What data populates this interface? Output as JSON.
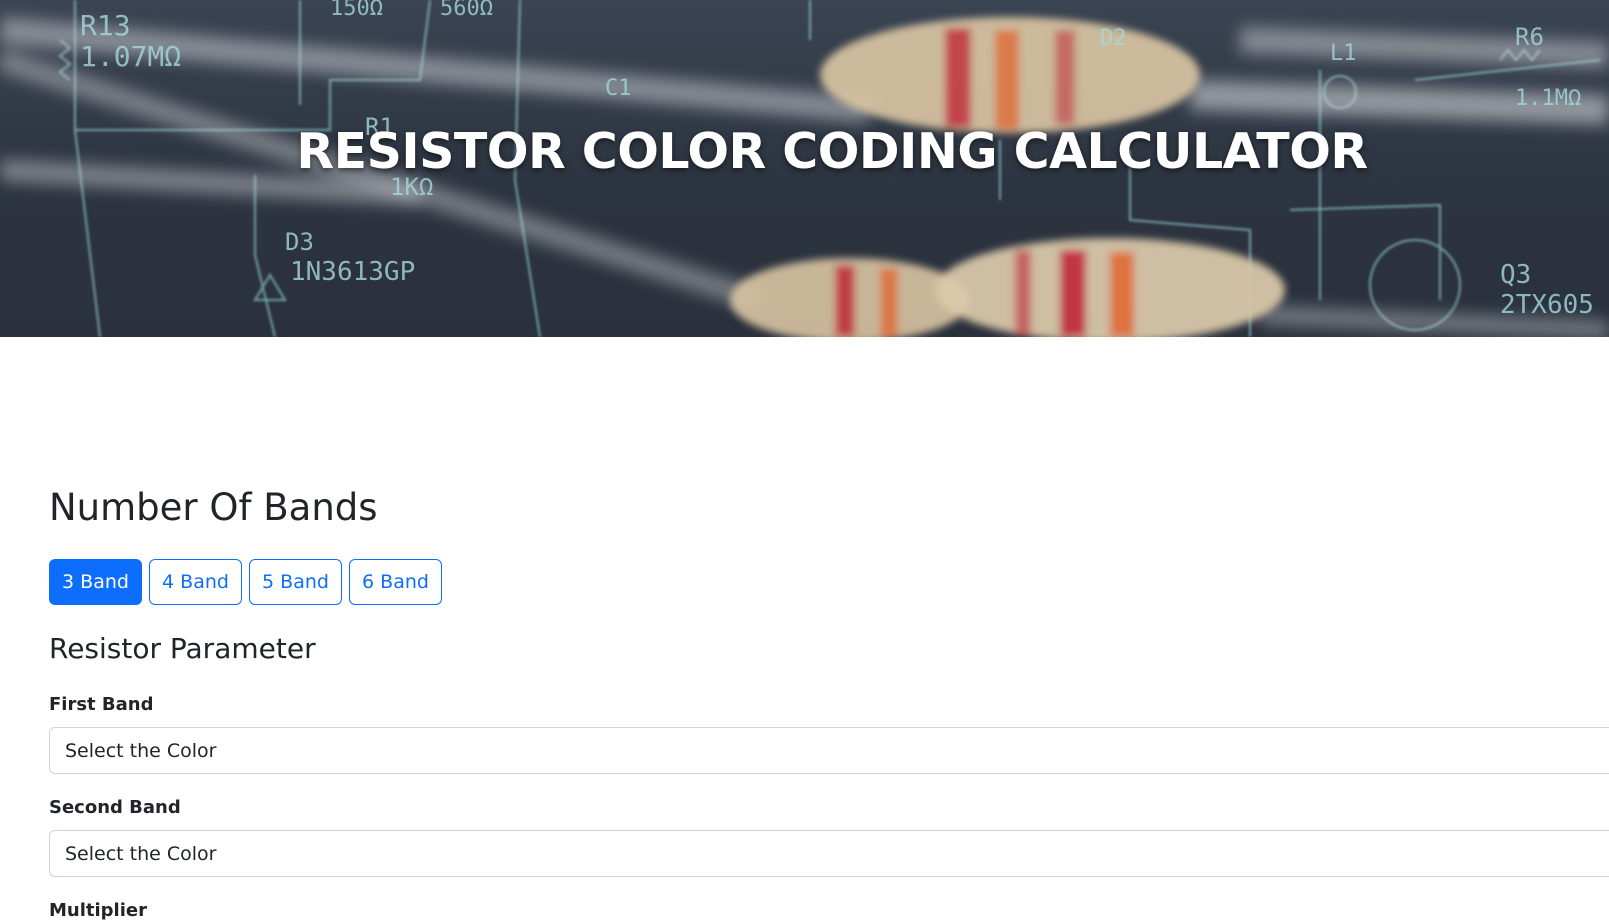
{
  "hero": {
    "title": "RESISTOR COLOR CODING CALCULATOR",
    "background_colors": {
      "board": "#2c3440",
      "trace": "#9fd8dc",
      "resistor_body": "#d9c4a3",
      "band_red": "#c0283a",
      "band_orange": "#e0662e"
    },
    "background_labels": [
      "R13",
      "1.07MΩ",
      "R1",
      "1KΩ",
      "D3",
      "1N3613GP",
      "Q3",
      "2TX605",
      "R6",
      "1.1MΩ",
      "150Ω",
      "560Ω",
      "C1",
      "D2",
      "L1"
    ]
  },
  "bands": {
    "heading": "Number Of Bands",
    "options": [
      "3 Band",
      "4 Band",
      "5 Band",
      "6 Band"
    ],
    "selected": "3 Band",
    "accent_color": "#0d6efd"
  },
  "parameters": {
    "heading": "Resistor Parameter",
    "fields": [
      {
        "label": "First Band",
        "value": "Select the Color"
      },
      {
        "label": "Second Band",
        "value": "Select the Color"
      },
      {
        "label": "Multiplier"
      }
    ]
  }
}
